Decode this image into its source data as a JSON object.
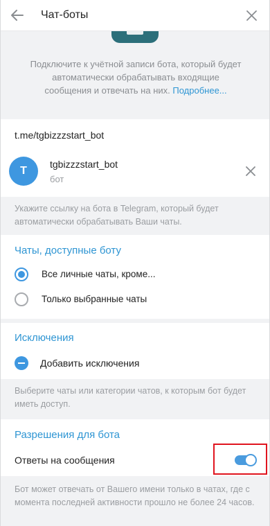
{
  "header": {
    "title": "Чат-боты"
  },
  "intro": {
    "text": "Подключите к учётной записи бота, который будет автоматически обрабатывать входящие сообщения и отвечать на них.",
    "more_link": "Подробнее..."
  },
  "bot_link": {
    "value": "t.me/tgbizzzstart_bot",
    "bot_name": "tgbizzzstart_bot",
    "bot_type": "бот",
    "avatar_letter": "T",
    "hint": "Укажите ссылку на бота в Telegram, который будет автоматически обрабатывать Ваши чаты."
  },
  "chats_section": {
    "title": "Чаты, доступные боту",
    "options": [
      {
        "label": "Все личные чаты, кроме...",
        "selected": true
      },
      {
        "label": "Только выбранные чаты",
        "selected": false
      }
    ]
  },
  "exclusions_section": {
    "title": "Исключения",
    "add_label": "Добавить исключения",
    "hint": "Выберите чаты или категории чатов, к которым бот будет иметь доступ."
  },
  "permissions_section": {
    "title": "Разрешения для бота",
    "reply_label": "Ответы на сообщения",
    "reply_enabled": true,
    "hint": "Бот может отвечать от Вашего имени только в чатах, где с момента последней активности прошло не более 24 часов."
  },
  "colors": {
    "accent": "#3e97e0",
    "link": "#2e95d3",
    "highlight_box": "#e0141e",
    "background": "#f1f2f4"
  },
  "icons": [
    "back-arrow-icon",
    "close-icon",
    "remove-icon",
    "minus-circle-icon"
  ]
}
